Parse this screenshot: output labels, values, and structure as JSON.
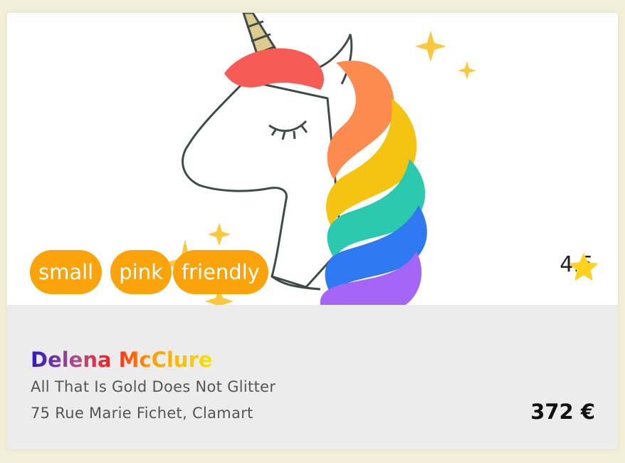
{
  "card": {
    "tags": [
      "small",
      "pink",
      "friendly"
    ],
    "rating": "4.5",
    "name": "Delena McClure",
    "subtitle": "All That Is Gold Does Not Glitter",
    "address": "75 Rue Marie Fichet, Clamart",
    "price": "372 €",
    "image_icon": "unicorn-illustration",
    "rating_icon": "star-icon"
  },
  "colors": {
    "tag_bg": "#fba30b",
    "star": "#ffd21f",
    "info_bg": "#ececec"
  }
}
